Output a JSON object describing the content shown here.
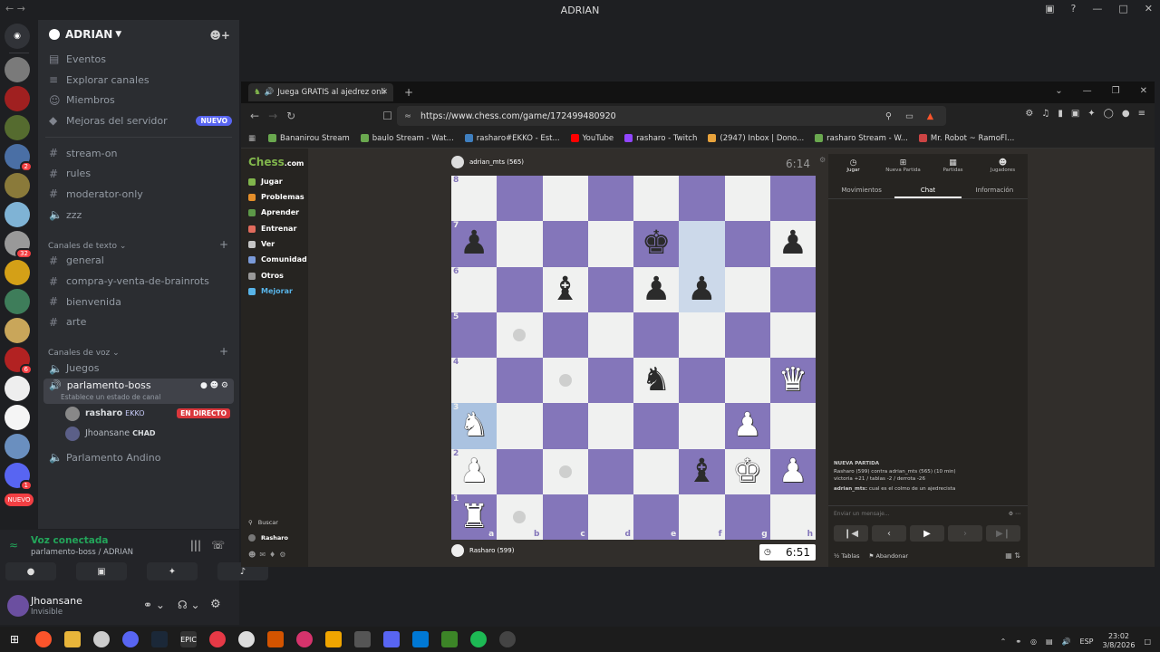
{
  "window": {
    "title": "ADRIAN"
  },
  "discord": {
    "server_name": "ADRIAN",
    "server_items": [
      {
        "label": "Eventos",
        "icon": "calendar-icon"
      },
      {
        "label": "Explorar canales",
        "icon": "list-icon"
      },
      {
        "label": "Miembros",
        "icon": "members-icon"
      },
      {
        "label": "Mejoras del servidor",
        "icon": "boost-icon",
        "badge": "NUEVO"
      }
    ],
    "channels_top": [
      "stream-on",
      "rules",
      "moderator-only",
      "zzz"
    ],
    "text_category": "Canales de texto",
    "text_channels": [
      "general",
      "compra-y-venta-de-brainrots",
      "bienvenida",
      "arte"
    ],
    "voice_category": "Canales de voz",
    "voice_channels": {
      "juegos": "Juegos",
      "active": "parlamento-boss",
      "active_status": "Establece un estado de canal",
      "user1": "rasharo",
      "user1_tag": "EKKO",
      "user1_live": "EN DIRECTO",
      "user2": "Jhoansane",
      "user2_tag": "CHAD",
      "other": "Parlamento Andino"
    },
    "voice_connected": "Voz conectada",
    "voice_location": "parlamento-boss / ADRIAN",
    "user_name": "Jhoansane",
    "user_status": "Invisible",
    "server_badges": [
      "2",
      "32",
      "6",
      "1"
    ],
    "nuevo_label": "NUEVO"
  },
  "browser": {
    "tab_title": "Juega GRATIS al ajedrez onli",
    "url": "https://www.chess.com/game/172499480920",
    "bookmarks": [
      {
        "label": "Bananirou Stream",
        "color": "#6aa84f"
      },
      {
        "label": "baulo Stream - Wat...",
        "color": "#6aa84f"
      },
      {
        "label": "rasharo#EKKO - Est...",
        "color": "#3f7fbf"
      },
      {
        "label": "YouTube",
        "color": "#ff0000"
      },
      {
        "label": "rasharo - Twitch",
        "color": "#9146ff"
      },
      {
        "label": "(2947) Inbox | Dono...",
        "color": "#e8a33c"
      },
      {
        "label": "rasharo Stream - W...",
        "color": "#6aa84f"
      },
      {
        "label": "Mr. Robot ~ RamoFl...",
        "color": "#cc4444"
      }
    ]
  },
  "chess": {
    "logo_a": "Chess",
    "logo_b": ".com",
    "nav": [
      {
        "label": "Jugar",
        "color": "#81b64c"
      },
      {
        "label": "Problemas",
        "color": "#e58f2a"
      },
      {
        "label": "Aprender",
        "color": "#5d9948"
      },
      {
        "label": "Entrenar",
        "color": "#e16b5c"
      },
      {
        "label": "Ver",
        "color": "#c5c5c5"
      },
      {
        "label": "Comunidad",
        "color": "#7a9ad8"
      },
      {
        "label": "Otros",
        "color": "#999999"
      },
      {
        "label": "Mejorar",
        "color": "#58b4e8"
      }
    ],
    "search_label": "Buscar",
    "user_label": "Rasharo",
    "top_player": "adrian_mts (565)",
    "top_clock": "6:14",
    "bottom_player": "Rasharo (599)",
    "bottom_clock": "6:51",
    "files": [
      "a",
      "b",
      "c",
      "d",
      "e",
      "f",
      "g",
      "h"
    ],
    "ranks": [
      "8",
      "7",
      "6",
      "5",
      "4",
      "3",
      "2",
      "1"
    ],
    "tabs": [
      "Jugar",
      "Nueva Partida",
      "Partidas",
      "Jugadores"
    ],
    "subtabs": [
      "Movimientos",
      "Chat",
      "Información"
    ],
    "chat_heading": "NUEVA PARTIDA",
    "chat_line1": "Rasharo (599) contra adrian_mts (565) (10 min)",
    "chat_line2": "victoria +21 / tablas -2 / derrota -26",
    "chat_msg_user": "adrian_mts:",
    "chat_msg": "cual es el colmo de un ajedrecista",
    "chat_placeholder": "Enviar un mensaje...",
    "draw_label": "Tablas",
    "resign_label": "Abandonar"
  },
  "taskbar": {
    "lang": "ESP",
    "time": "23:02",
    "date": "3/8/2026"
  }
}
